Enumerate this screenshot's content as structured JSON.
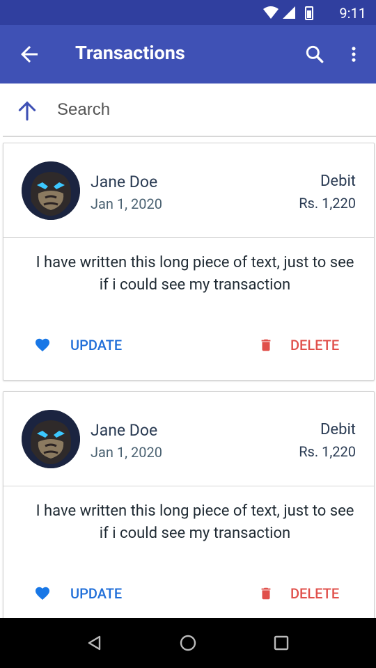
{
  "status_bar": {
    "time": "9:11"
  },
  "app_bar": {
    "title": "Transactions"
  },
  "search": {
    "placeholder": "Search"
  },
  "transactions": [
    {
      "name": "Jane Doe",
      "date": "Jan 1, 2020",
      "type": "Debit",
      "amount": "Rs. 1,220",
      "description": "I have written this long piece of text, just to see if i could see my transaction",
      "update_label": "UPDATE",
      "delete_label": "DELETE"
    },
    {
      "name": "Jane Doe",
      "date": "Jan 1, 2020",
      "type": "Debit",
      "amount": "Rs. 1,220",
      "description": "I have written this long piece of text, just to see if i could see my transaction",
      "update_label": "UPDATE",
      "delete_label": "DELETE"
    }
  ],
  "colors": {
    "app_bar": "#3F51B5",
    "status_bar": "#303F9F",
    "update": "#1f6ed8",
    "delete": "#e0504b"
  },
  "icons": {
    "status": [
      "wifi-icon",
      "signal-icon",
      "battery-icon"
    ],
    "app_bar": [
      "back-arrow-icon",
      "search-icon",
      "more-vert-icon"
    ],
    "search_bar": [
      "arrow-up-icon",
      "search-icon"
    ],
    "card": [
      "gorilla-avatar",
      "heart-icon",
      "trash-icon"
    ],
    "nav": [
      "back-triangle-icon",
      "home-circle-icon",
      "recents-square-icon"
    ]
  }
}
